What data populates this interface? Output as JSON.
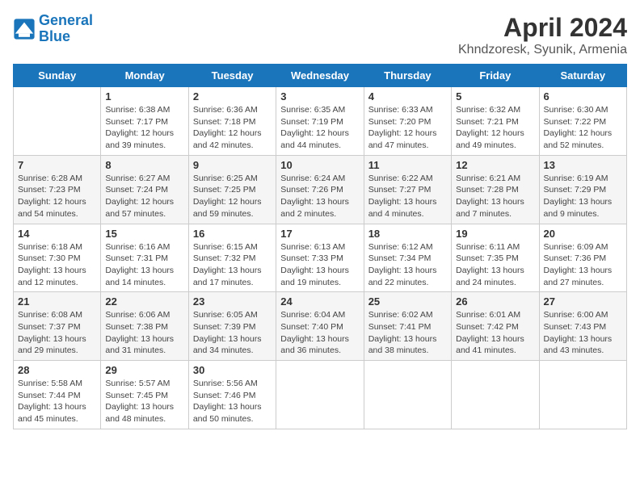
{
  "header": {
    "logo_line1": "General",
    "logo_line2": "Blue",
    "title": "April 2024",
    "subtitle": "Khndzoresk, Syunik, Armenia"
  },
  "columns": [
    "Sunday",
    "Monday",
    "Tuesday",
    "Wednesday",
    "Thursday",
    "Friday",
    "Saturday"
  ],
  "weeks": [
    [
      {
        "day": "",
        "info": ""
      },
      {
        "day": "1",
        "info": "Sunrise: 6:38 AM\nSunset: 7:17 PM\nDaylight: 12 hours\nand 39 minutes."
      },
      {
        "day": "2",
        "info": "Sunrise: 6:36 AM\nSunset: 7:18 PM\nDaylight: 12 hours\nand 42 minutes."
      },
      {
        "day": "3",
        "info": "Sunrise: 6:35 AM\nSunset: 7:19 PM\nDaylight: 12 hours\nand 44 minutes."
      },
      {
        "day": "4",
        "info": "Sunrise: 6:33 AM\nSunset: 7:20 PM\nDaylight: 12 hours\nand 47 minutes."
      },
      {
        "day": "5",
        "info": "Sunrise: 6:32 AM\nSunset: 7:21 PM\nDaylight: 12 hours\nand 49 minutes."
      },
      {
        "day": "6",
        "info": "Sunrise: 6:30 AM\nSunset: 7:22 PM\nDaylight: 12 hours\nand 52 minutes."
      }
    ],
    [
      {
        "day": "7",
        "info": "Sunrise: 6:28 AM\nSunset: 7:23 PM\nDaylight: 12 hours\nand 54 minutes."
      },
      {
        "day": "8",
        "info": "Sunrise: 6:27 AM\nSunset: 7:24 PM\nDaylight: 12 hours\nand 57 minutes."
      },
      {
        "day": "9",
        "info": "Sunrise: 6:25 AM\nSunset: 7:25 PM\nDaylight: 12 hours\nand 59 minutes."
      },
      {
        "day": "10",
        "info": "Sunrise: 6:24 AM\nSunset: 7:26 PM\nDaylight: 13 hours\nand 2 minutes."
      },
      {
        "day": "11",
        "info": "Sunrise: 6:22 AM\nSunset: 7:27 PM\nDaylight: 13 hours\nand 4 minutes."
      },
      {
        "day": "12",
        "info": "Sunrise: 6:21 AM\nSunset: 7:28 PM\nDaylight: 13 hours\nand 7 minutes."
      },
      {
        "day": "13",
        "info": "Sunrise: 6:19 AM\nSunset: 7:29 PM\nDaylight: 13 hours\nand 9 minutes."
      }
    ],
    [
      {
        "day": "14",
        "info": "Sunrise: 6:18 AM\nSunset: 7:30 PM\nDaylight: 13 hours\nand 12 minutes."
      },
      {
        "day": "15",
        "info": "Sunrise: 6:16 AM\nSunset: 7:31 PM\nDaylight: 13 hours\nand 14 minutes."
      },
      {
        "day": "16",
        "info": "Sunrise: 6:15 AM\nSunset: 7:32 PM\nDaylight: 13 hours\nand 17 minutes."
      },
      {
        "day": "17",
        "info": "Sunrise: 6:13 AM\nSunset: 7:33 PM\nDaylight: 13 hours\nand 19 minutes."
      },
      {
        "day": "18",
        "info": "Sunrise: 6:12 AM\nSunset: 7:34 PM\nDaylight: 13 hours\nand 22 minutes."
      },
      {
        "day": "19",
        "info": "Sunrise: 6:11 AM\nSunset: 7:35 PM\nDaylight: 13 hours\nand 24 minutes."
      },
      {
        "day": "20",
        "info": "Sunrise: 6:09 AM\nSunset: 7:36 PM\nDaylight: 13 hours\nand 27 minutes."
      }
    ],
    [
      {
        "day": "21",
        "info": "Sunrise: 6:08 AM\nSunset: 7:37 PM\nDaylight: 13 hours\nand 29 minutes."
      },
      {
        "day": "22",
        "info": "Sunrise: 6:06 AM\nSunset: 7:38 PM\nDaylight: 13 hours\nand 31 minutes."
      },
      {
        "day": "23",
        "info": "Sunrise: 6:05 AM\nSunset: 7:39 PM\nDaylight: 13 hours\nand 34 minutes."
      },
      {
        "day": "24",
        "info": "Sunrise: 6:04 AM\nSunset: 7:40 PM\nDaylight: 13 hours\nand 36 minutes."
      },
      {
        "day": "25",
        "info": "Sunrise: 6:02 AM\nSunset: 7:41 PM\nDaylight: 13 hours\nand 38 minutes."
      },
      {
        "day": "26",
        "info": "Sunrise: 6:01 AM\nSunset: 7:42 PM\nDaylight: 13 hours\nand 41 minutes."
      },
      {
        "day": "27",
        "info": "Sunrise: 6:00 AM\nSunset: 7:43 PM\nDaylight: 13 hours\nand 43 minutes."
      }
    ],
    [
      {
        "day": "28",
        "info": "Sunrise: 5:58 AM\nSunset: 7:44 PM\nDaylight: 13 hours\nand 45 minutes."
      },
      {
        "day": "29",
        "info": "Sunrise: 5:57 AM\nSunset: 7:45 PM\nDaylight: 13 hours\nand 48 minutes."
      },
      {
        "day": "30",
        "info": "Sunrise: 5:56 AM\nSunset: 7:46 PM\nDaylight: 13 hours\nand 50 minutes."
      },
      {
        "day": "",
        "info": ""
      },
      {
        "day": "",
        "info": ""
      },
      {
        "day": "",
        "info": ""
      },
      {
        "day": "",
        "info": ""
      }
    ]
  ]
}
